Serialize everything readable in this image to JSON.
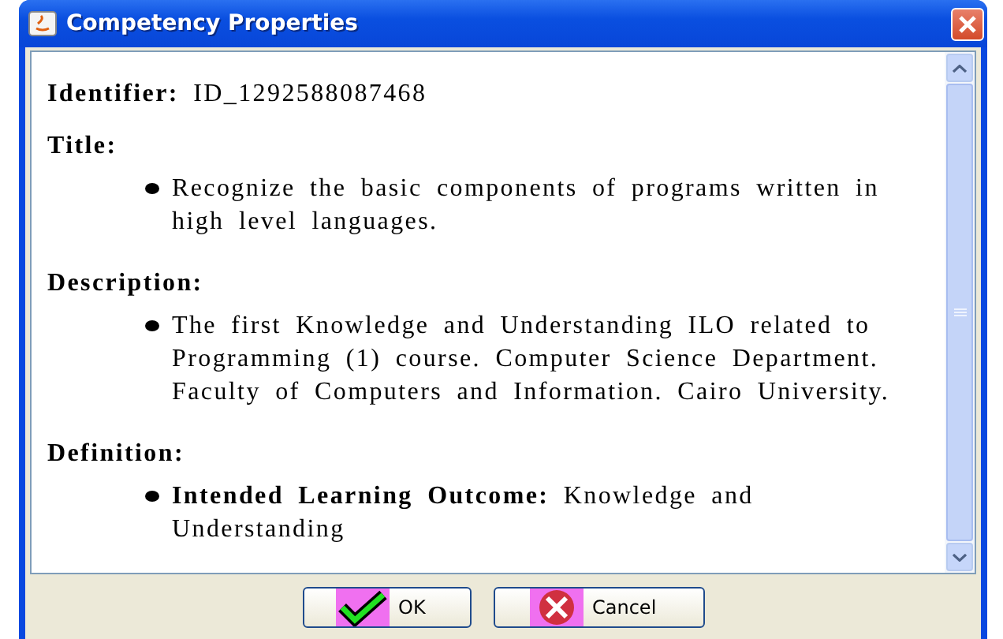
{
  "window": {
    "title": "Competency Properties"
  },
  "identifier": {
    "label": "Identifier:",
    "value": "ID_1292588087468"
  },
  "sections": [
    {
      "heading": "Title:",
      "bullets": [
        "Recognize the basic components of programs written in high level languages."
      ]
    },
    {
      "heading": "Description:",
      "bullets": [
        "The first Knowledge and Understanding ILO related to Programming (1) course. Computer Science Department. Faculty of Computers and Information. Cairo University."
      ]
    },
    {
      "heading": "Definition:",
      "bullets": [
        "**Intended Learning Outcome:** Knowledge and Understanding"
      ]
    }
  ],
  "buttons": [
    {
      "kind": "ok",
      "label": "OK"
    },
    {
      "kind": "cancel",
      "label": "Cancel"
    }
  ]
}
